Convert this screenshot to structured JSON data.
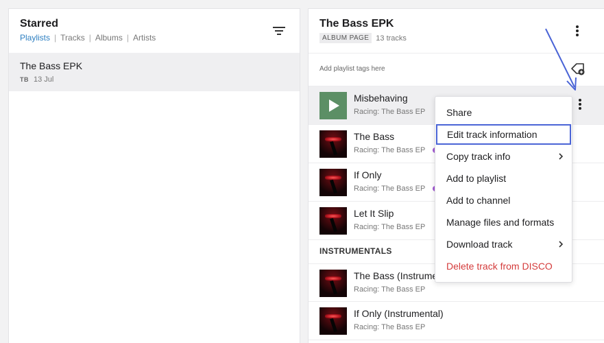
{
  "starred": {
    "title": "Starred",
    "tabs": [
      "Playlists",
      "Tracks",
      "Albums",
      "Artists"
    ],
    "playlists": [
      {
        "name": "The Bass EPK",
        "initials": "TB",
        "date": "13 Jul"
      }
    ]
  },
  "playlist": {
    "title": "The Bass EPK",
    "badge": "ALBUM PAGE",
    "track_count": "13 tracks",
    "tags_placeholder": "Add playlist tags here",
    "tracks": [
      {
        "title": "Misbehaving",
        "subtitle": "Racing: The Bass EP"
      },
      {
        "title": "The Bass",
        "subtitle": "Racing: The Bass EP"
      },
      {
        "title": "If Only",
        "subtitle": "Racing: The Bass EP"
      },
      {
        "title": "Let It Slip",
        "subtitle": "Racing: The Bass EP"
      }
    ],
    "section": "INSTRUMENTALS",
    "instrumental_tracks": [
      {
        "title": "The Bass (Instrumental)",
        "subtitle": "Racing: The Bass EP"
      },
      {
        "title": "If Only (Instrumental)",
        "subtitle": "Racing: The Bass EP"
      }
    ]
  },
  "context_menu": {
    "items": [
      {
        "label": "Share"
      },
      {
        "label": "Edit track information",
        "highlighted": true
      },
      {
        "label": "Copy track info",
        "submenu": true
      },
      {
        "label": "Add to playlist"
      },
      {
        "label": "Add to channel"
      },
      {
        "label": "Manage files and formats"
      },
      {
        "label": "Download track",
        "submenu": true
      },
      {
        "label": "Delete track from DISCO",
        "danger": true
      }
    ]
  },
  "colors": {
    "accent_blue": "#2d7fc1",
    "annotation": "#4a64d6",
    "danger": "#d43b3b",
    "play_tile": "#5c8f65",
    "tag_dot": "#a35bd3"
  }
}
